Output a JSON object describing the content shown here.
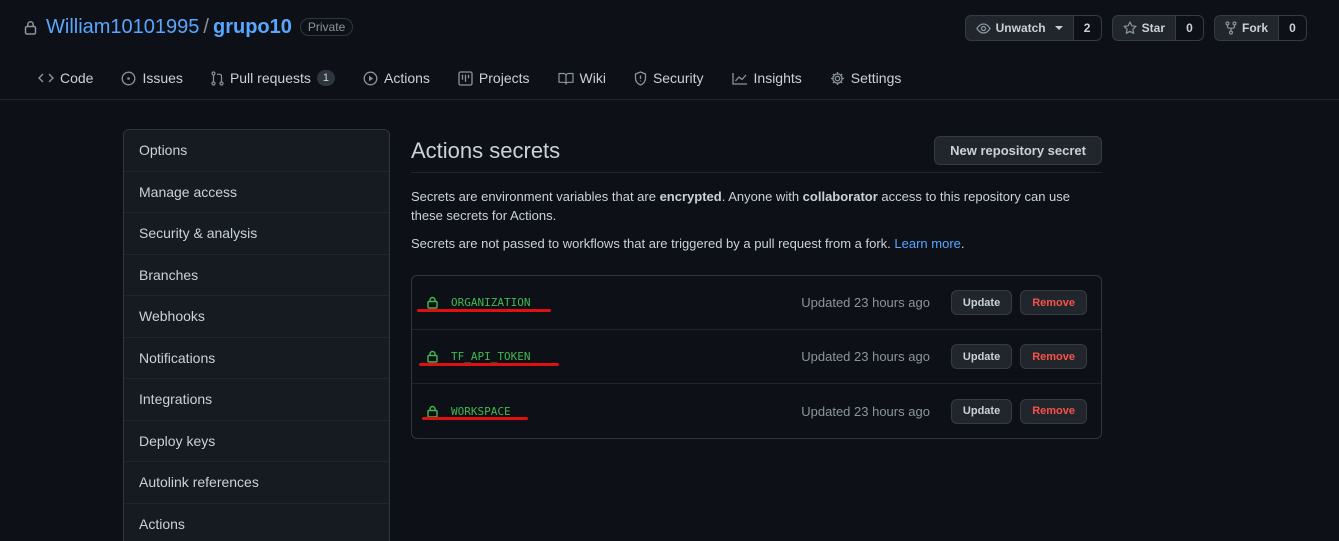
{
  "repo": {
    "owner": "William10101995",
    "separator": "/",
    "name": "grupo10",
    "visibility": "Private"
  },
  "repo_actions": {
    "watch": {
      "label": "Unwatch",
      "count": "2"
    },
    "star": {
      "label": "Star",
      "count": "0"
    },
    "fork": {
      "label": "Fork",
      "count": "0"
    }
  },
  "tabs": [
    {
      "label": "Code",
      "icon": "code-icon"
    },
    {
      "label": "Issues",
      "icon": "issue-icon"
    },
    {
      "label": "Pull requests",
      "icon": "pull-request-icon",
      "counter": "1"
    },
    {
      "label": "Actions",
      "icon": "play-icon"
    },
    {
      "label": "Projects",
      "icon": "project-icon"
    },
    {
      "label": "Wiki",
      "icon": "book-icon"
    },
    {
      "label": "Security",
      "icon": "shield-icon"
    },
    {
      "label": "Insights",
      "icon": "graph-icon"
    },
    {
      "label": "Settings",
      "icon": "gear-icon"
    }
  ],
  "sidebar": {
    "items": [
      {
        "label": "Options"
      },
      {
        "label": "Manage access"
      },
      {
        "label": "Security & analysis"
      },
      {
        "label": "Branches"
      },
      {
        "label": "Webhooks"
      },
      {
        "label": "Notifications"
      },
      {
        "label": "Integrations"
      },
      {
        "label": "Deploy keys"
      },
      {
        "label": "Autolink references"
      },
      {
        "label": "Actions"
      }
    ]
  },
  "main": {
    "title": "Actions secrets",
    "new_button": "New repository secret",
    "desc1_a": "Secrets are environment variables that are ",
    "desc1_b": "encrypted",
    "desc1_c": ". Anyone with ",
    "desc1_d": "collaborator",
    "desc1_e": " access to this repository can use these secrets for Actions.",
    "desc2_a": "Secrets are not passed to workflows that are triggered by a pull request from a fork. ",
    "desc2_link": "Learn more",
    "desc2_end": "."
  },
  "secrets": [
    {
      "name": "ORGANIZATION",
      "updated": "Updated 23 hours ago",
      "update_label": "Update",
      "remove_label": "Remove"
    },
    {
      "name": "TF_API_TOKEN",
      "updated": "Updated 23 hours ago",
      "update_label": "Update",
      "remove_label": "Remove"
    },
    {
      "name": "WORKSPACE",
      "updated": "Updated 23 hours ago",
      "update_label": "Update",
      "remove_label": "Remove"
    }
  ],
  "colors": {
    "background": "#0d1117",
    "link": "#58a6ff",
    "secret_name": "#3fb950",
    "danger": "#f85149",
    "annotation_underline": "#e01010"
  }
}
